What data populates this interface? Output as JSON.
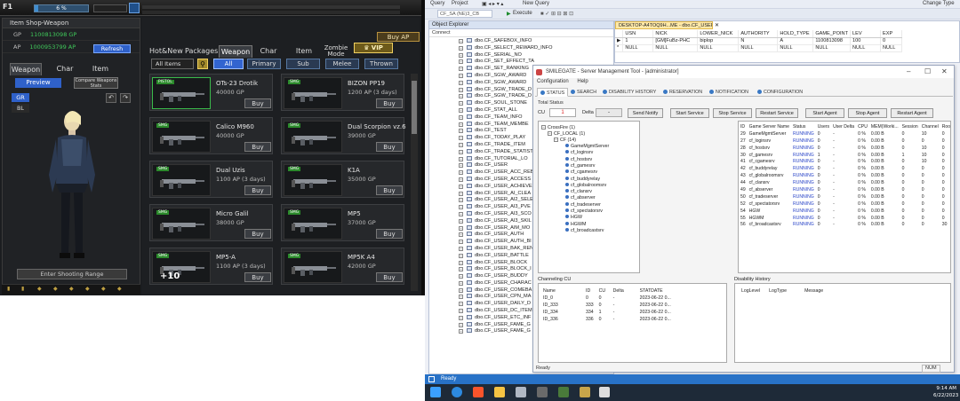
{
  "game": {
    "level_label": "F1",
    "exp_percent": 6,
    "exp_text": "6 %",
    "shop_title": "Item Shop-Weapon",
    "gp_label": "GP",
    "gp_value": "1100813098 GP",
    "ap_label": "AP",
    "ap_value": "1000953799 AP",
    "refresh_label": "Refresh",
    "left_tabs": [
      "Weapon",
      "Char",
      "Item"
    ],
    "preview_label": "Preview",
    "compare_label": "Compare Weapons Stats",
    "gr_label": "GR",
    "bl_label": "BL",
    "shooting_range_label": "Enter Shooting Range",
    "buy_ap_label": "Buy AP",
    "shop_tabs": [
      "Hot&New",
      "Packages",
      "Weapon",
      "Char",
      "Item",
      "Zombie Mode"
    ],
    "vip_label": "VIP",
    "all_items_label": "All Items",
    "filters": [
      "All",
      "Primary",
      "Sub",
      "Melee",
      "Thrown"
    ],
    "buy_label": "Buy",
    "plus_badge": "+10",
    "items": [
      {
        "name": "OTs-23 Drotik",
        "price": "40000 GP",
        "tag": "PISTOL"
      },
      {
        "name": "BIZON PP19",
        "price": "1200 AP (3 days)",
        "tag": "SMG"
      },
      {
        "name": "Calico M960",
        "price": "40000 GP",
        "tag": "SMG"
      },
      {
        "name": "Dual Scorpion vz.6",
        "price": "39000 GP",
        "tag": "SMG"
      },
      {
        "name": "Dual Uzis",
        "price": "1100 AP (3 days)",
        "tag": "SMG"
      },
      {
        "name": "K1A",
        "price": "35000 GP",
        "tag": "SMG"
      },
      {
        "name": "Micro Galil",
        "price": "38000 GP",
        "tag": "SMG"
      },
      {
        "name": "MP5",
        "price": "37000 GP",
        "tag": "SMG"
      },
      {
        "name": "MP5-A",
        "price": "1100 AP (3 days)",
        "tag": "SMG"
      },
      {
        "name": "MP5K A4",
        "price": "42000 GP",
        "tag": "SMG"
      }
    ]
  },
  "ssms": {
    "menu": [
      "Query",
      "Project",
      "Tools",
      "Window",
      "Help"
    ],
    "new_query_label": "New Query",
    "execute_label": "Execute",
    "change_type_label": "Change Type",
    "db_dropdown": "CF_SA (NE)3_CB",
    "object_explorer_title": "Object Explorer",
    "connect_label": "Connect",
    "oe_items": [
      "dbo.CF_SAFEBOX_INFO",
      "dbo.CF_SELECT_REWARD_INFO",
      "dbo.CF_SERIAL_NO",
      "dbo.CF_SET_EFFECT_TA",
      "dbo.CF_SET_RANKING",
      "dbo.CF_SGW_AWARD",
      "dbo.CF_SGW_AWARD",
      "dbo.CF_SGW_TRADE_D",
      "dbo.CF_SGW_TRADE_D",
      "dbo.CF_SOUL_STONE",
      "dbo.CF_STAT_ALL",
      "dbo.CF_TEAM_INFO",
      "dbo.CF_TEAM_MEMBE",
      "dbo.CF_TEST",
      "dbo.CF_TODAY_PLAY",
      "dbo.CF_TRADE_ITEM",
      "dbo.CF_TRADE_STATIST",
      "dbo.CF_TUTORIAL_LO",
      "dbo.CF_USER",
      "dbo.CF_USER_ACC_REB",
      "dbo.CF_USER_ACCESS",
      "dbo.CF_USER_ACHIEVE",
      "dbo.CF_USER_AI_CLEA",
      "dbo.CF_USER_AI2_SELE",
      "dbo.CF_USER_AI3_PVE",
      "dbo.CF_USER_AI3_SCO",
      "dbo.CF_USER_AI3_SKIL",
      "dbo.CF_USER_AIM_MO",
      "dbo.CF_USER_AUTH",
      "dbo.CF_USER_AUTH_BI",
      "dbo.CF_USER_BAK_REN",
      "dbo.CF_USER_BATTLE",
      "dbo.CF_USER_BLOCK",
      "dbo.CF_USER_BLOCK_I",
      "dbo.CF_USER_BUDDY",
      "dbo.CF_USER_CHARAC",
      "dbo.CF_USER_COMEBA",
      "dbo.CF_USER_CPN_MA",
      "dbo.CF_USER_DAILY_D",
      "dbo.CF_USER_DC_ITEM",
      "dbo.CF_USER_ETC_INF",
      "dbo.CF_USER_FAME_G",
      "dbo.CF_USER_FAME_G"
    ],
    "query_tab": "DESKTOP-A4TOQ9H...ME - dbo.CF_USER",
    "result_headers": [
      "",
      "USN",
      "NICK",
      "LOWER_NICK",
      "AUTHORITY",
      "HOLD_TYPE",
      "GAME_POINT",
      "LEV",
      "EXP"
    ],
    "result_rows": [
      [
        "▶",
        "1",
        "[GM]FuBz-PHC",
        "biplop",
        "N",
        "A",
        "1100813098",
        "100",
        "0"
      ],
      [
        "*",
        "NULL",
        "NULL",
        "NULL",
        "NULL",
        "NULL",
        "NULL",
        "NULL",
        "NULL"
      ]
    ],
    "status_text": "Ready"
  },
  "smt": {
    "title": "SMILEGATE - Server Management Tool - [administrator]",
    "menu": [
      "Configuration",
      "Help"
    ],
    "tabs": [
      "STATUS",
      "SEARCH",
      "DISABILITY HISTORY",
      "RESERVATION",
      "NOTIFICATION",
      "CONFIGURATION"
    ],
    "total_status_label": "Total Status",
    "cu_label": "CU",
    "cu_value": "1",
    "delta_label": "Delta",
    "delta_value": "-",
    "buttons": [
      "Send Notify",
      "Start Service",
      "Stop Service",
      "Restart Service",
      "Start Agent",
      "Stop Agent",
      "Restart Agent"
    ],
    "tree": {
      "root": "CrossFire (1)",
      "local": "CF_LOCAL (1)",
      "cf": "CF (14)",
      "services": [
        "GameMgmtServer",
        "cf_loginsrv",
        "cf_hostsrv",
        "cf_gamesrv",
        "cf_cgamesrv",
        "cf_buddyrelay",
        "cf_globalroomsrv",
        "cf_clansrv",
        "cf_abserver",
        "cf_tradeserver",
        "cf_spectatorsrv",
        "HGW",
        "HGWM",
        "cf_broadcastsrv"
      ]
    },
    "server_headers": [
      "ID",
      "Game Server Name",
      "Status",
      "Users",
      "User Delta",
      "CPU",
      "MEM(Worki...",
      "Session",
      "Channel",
      "Room",
      "Frame"
    ],
    "servers": [
      [
        "29",
        "GameMgmtServer",
        "RUNNING",
        "0",
        "-",
        "0 %",
        "0.00 B",
        "0",
        "10",
        "0",
        "0"
      ],
      [
        "27",
        "cf_loginsrv",
        "RUNNING",
        "0",
        "-",
        "0 %",
        "0.00 B",
        "0",
        "0",
        "0",
        "0"
      ],
      [
        "28",
        "cf_hostsrv",
        "RUNNING",
        "0",
        "-",
        "0 %",
        "0.00 B",
        "0",
        "10",
        "0",
        "0"
      ],
      [
        "30",
        "cf_gamesrv",
        "RUNNING",
        "1",
        "-",
        "0 %",
        "0.00 B",
        "1",
        "10",
        "0",
        "0"
      ],
      [
        "41",
        "cf_cgamesrv",
        "RUNNING",
        "0",
        "-",
        "0 %",
        "0.00 B",
        "0",
        "10",
        "0",
        "0"
      ],
      [
        "42",
        "cf_buddyrelay",
        "RUNNING",
        "0",
        "-",
        "0 %",
        "0.00 B",
        "0",
        "0",
        "0",
        "0"
      ],
      [
        "43",
        "cf_globalroomsrv",
        "RUNNING",
        "0",
        "-",
        "0 %",
        "0.00 B",
        "0",
        "0",
        "0",
        "0"
      ],
      [
        "44",
        "cf_clansrv",
        "RUNNING",
        "0",
        "-",
        "0 %",
        "0.00 B",
        "0",
        "0",
        "0",
        "0"
      ],
      [
        "49",
        "cf_abserver",
        "RUNNING",
        "0",
        "-",
        "0 %",
        "0.00 B",
        "0",
        "0",
        "0",
        "0"
      ],
      [
        "50",
        "cf_tradeserver",
        "RUNNING",
        "0",
        "-",
        "0 %",
        "0.00 B",
        "0",
        "0",
        "0",
        "0"
      ],
      [
        "52",
        "cf_spectatorsrv",
        "RUNNING",
        "0",
        "-",
        "0 %",
        "0.00 B",
        "0",
        "0",
        "0",
        "0"
      ],
      [
        "54",
        "HGW",
        "RUNNING",
        "0",
        "-",
        "0 %",
        "0.00 B",
        "0",
        "0",
        "0",
        "0"
      ],
      [
        "55",
        "HGWM",
        "RUNNING",
        "0",
        "-",
        "0 %",
        "0.00 B",
        "0",
        "0",
        "0",
        "0"
      ],
      [
        "56",
        "cf_broadcastsrv",
        "RUNNING",
        "0",
        "-",
        "0 %",
        "0.00 B",
        "0",
        "0",
        "30",
        "0"
      ]
    ],
    "channeling_label": "Channeling CU",
    "channel_headers": [
      "Name",
      "ID",
      "CU",
      "Delta",
      "STATDATE"
    ],
    "channels": [
      [
        "ID_0",
        "0",
        "0",
        "-",
        "2023-06-22 0..."
      ],
      [
        "ID_333",
        "333",
        "0",
        "-",
        "2023-06-22 0..."
      ],
      [
        "ID_334",
        "334",
        "1",
        "-",
        "2023-06-22 0..."
      ],
      [
        "ID_336",
        "336",
        "0",
        "-",
        "2023-06-22 0..."
      ]
    ],
    "disability_label": "Disability History",
    "disability_headers": [
      "LogLevel",
      "LogType",
      "Message"
    ],
    "status": "Ready",
    "num_label": "NUM"
  },
  "taskbar": {
    "time": "9:14 AM",
    "date": "6/22/2023",
    "icons": [
      "windows-start",
      "explorer",
      "brave",
      "folder",
      "chat",
      "terminal",
      "crossfire"
    ]
  }
}
